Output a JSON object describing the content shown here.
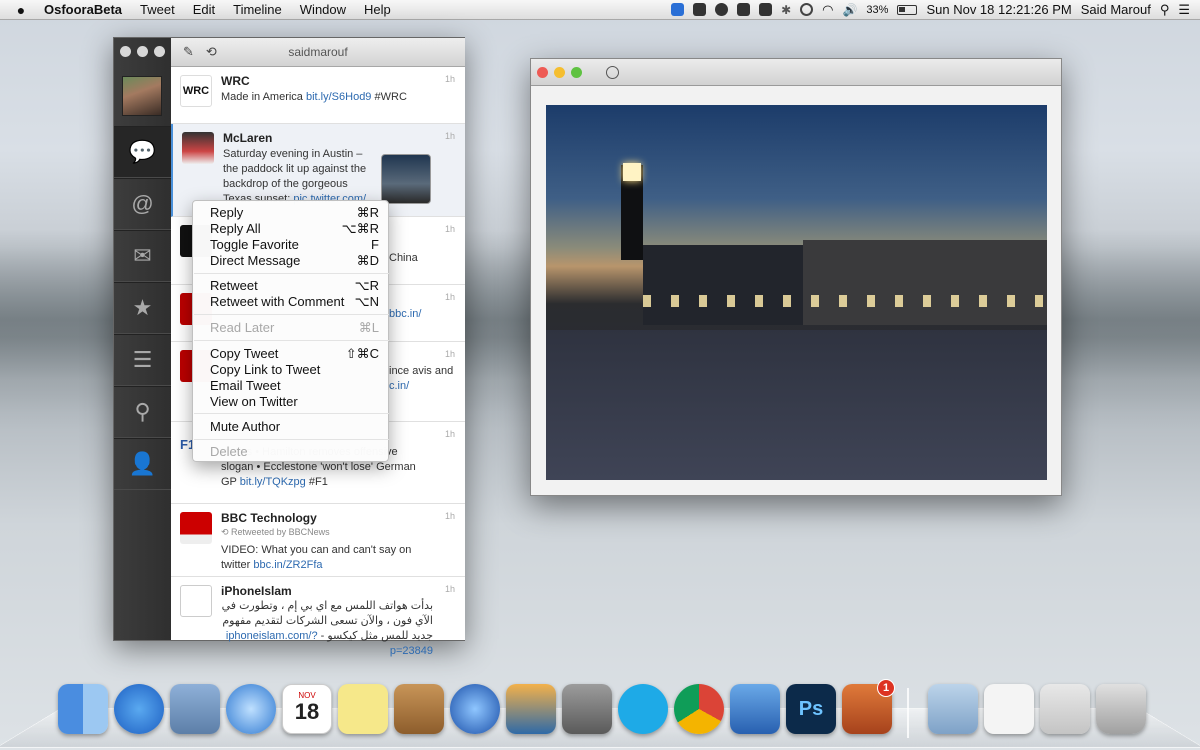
{
  "menubar": {
    "apple": "",
    "items": [
      "OsfooraBeta",
      "Tweet",
      "Edit",
      "Timeline",
      "Window",
      "Help"
    ],
    "battery": "33%",
    "clock": "Sun Nov 18  12:21:26 PM",
    "user": "Said Marouf"
  },
  "app": {
    "account": "saidmarouf",
    "nav": [
      "timeline",
      "mentions",
      "messages",
      "favorites",
      "lists",
      "search",
      "profile"
    ]
  },
  "tweets": [
    {
      "name": "WRC",
      "time": "1h",
      "text": "Made in America",
      "link": "bit.ly/S6Hod9",
      "tail": "#WRC"
    },
    {
      "name": "McLaren",
      "time": "1h",
      "text": "Saturday evening in Austin – the paddock lit up against the backdrop of the gorgeous Texas sunset:",
      "link": "pic.twitter.com/"
    },
    {
      "time": "1h",
      "text": "China"
    },
    {
      "time": "1h",
      "link": "bbc.in/"
    },
    {
      "time": "1h",
      "text": "ince avis and",
      "link": "c.in/"
    },
    {
      "time": "1h",
      "text": "tactics • Hamilton removes offensive slogan • Ecclestone 'won't lose' German GP",
      "link": "bit.ly/TQKzpg",
      "tail": "#F1"
    },
    {
      "name": "BBC Technology",
      "time": "1h",
      "retweet": "Retweeted by BBCNews",
      "text": "VIDEO: What you can and can't say on twitter",
      "link": "bbc.in/ZR2Ffa"
    },
    {
      "name": "iPhoneIslam",
      "time": "1h",
      "text": "بدأت هواتف اللمس مع اي بي إم ، وتطورت في الآي فون ، والآن تسعى الشركات لتقديم مفهوم جديد للمس مثل كيكسو -",
      "link": "iphoneislam.com/?p=23849"
    }
  ],
  "context_menu": [
    {
      "label": "Reply",
      "shortcut": "⌘R"
    },
    {
      "label": "Reply All",
      "shortcut": "⌥⌘R"
    },
    {
      "label": "Toggle Favorite",
      "shortcut": "F"
    },
    {
      "label": "Direct Message",
      "shortcut": "⌘D"
    },
    {
      "label": "Retweet",
      "shortcut": "⌥R"
    },
    {
      "label": "Retweet with Comment",
      "shortcut": "⌥N"
    },
    {
      "label": "Read Later",
      "shortcut": "⌘L",
      "disabled": true
    },
    {
      "label": "Copy Tweet",
      "shortcut": "⇧⌘C"
    },
    {
      "label": "Copy Link to Tweet",
      "shortcut": ""
    },
    {
      "label": "Email Tweet",
      "shortcut": ""
    },
    {
      "label": "View on Twitter",
      "shortcut": ""
    },
    {
      "label": "Mute Author",
      "shortcut": ""
    },
    {
      "label": "Delete",
      "shortcut": "",
      "disabled": true
    }
  ],
  "dock": {
    "calendar_month": "NOV",
    "calendar_day": "18",
    "badge": "1",
    "apps": [
      "finder",
      "app-store",
      "mail",
      "safari",
      "calendar",
      "stickies",
      "omnifocus",
      "itunes",
      "iphoto",
      "system-preferences",
      "skype",
      "chrome",
      "xcode",
      "photoshop",
      "pockety",
      "applications-folder",
      "preview",
      "screenshot",
      "trash"
    ]
  },
  "colors": {
    "link": "#2d6ab0",
    "sidebar": "#333333",
    "close": "#ee5b55",
    "minimize": "#f5be2f",
    "zoom": "#5fc241"
  }
}
